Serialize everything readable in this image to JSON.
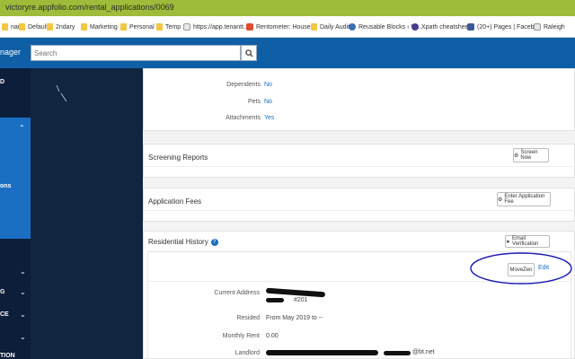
{
  "browser": {
    "url": "victoryre.appfolio.com/rental_applications/0069",
    "bookmarks": [
      {
        "label": "nary",
        "icon": "folder-icon"
      },
      {
        "label": "Default",
        "icon": "folder-icon"
      },
      {
        "label": "2ndary",
        "icon": "folder-icon"
      },
      {
        "label": "Marketing",
        "icon": "folder-icon"
      },
      {
        "label": "Personal",
        "icon": "folder-icon"
      },
      {
        "label": "Temp",
        "icon": "folder-icon"
      },
      {
        "label": "https://app.tenantt...",
        "icon": "page-icon"
      },
      {
        "label": "Rentometer: House...",
        "icon": "rentometer-icon"
      },
      {
        "label": "Daily Audit",
        "icon": "folder-icon"
      },
      {
        "label": "Reusable Blocks ‹ Vi...",
        "icon": "wordpress-icon"
      },
      {
        "label": "Xpath cheatsheet",
        "icon": "xpath-icon"
      },
      {
        "label": "(20+) Pages | Faceb...",
        "icon": "facebook-icon"
      },
      {
        "label": "Raleigh",
        "icon": "page-icon"
      }
    ]
  },
  "topnav": {
    "brand_fragment": "nager",
    "search_placeholder": "Search"
  },
  "sidebar": {
    "items": [
      {
        "label": "D"
      },
      {
        "label": "ons"
      },
      {
        "label": "G"
      },
      {
        "label": "CE"
      },
      {
        "label": "TION"
      }
    ]
  },
  "details": {
    "rows": [
      {
        "label": "Dependents",
        "value": "No"
      },
      {
        "label": "Pets",
        "value": "No"
      },
      {
        "label": "Attachments",
        "value": "Yes"
      }
    ]
  },
  "screening": {
    "title": "Screening Reports",
    "button": "Screen Now"
  },
  "fees": {
    "title": "Application Fees",
    "button": "Enter Application Fee"
  },
  "residential": {
    "title": "Residential History",
    "email_button": "Email Verification",
    "movein_button": "MoveZen",
    "edit_link": "Edit",
    "current_address_label": "Current Address",
    "address_fragment": "#201",
    "resided_label": "Resided",
    "resided_value": "From May 2019 to --",
    "rent_label": "Monthly Rent",
    "rent_value": "0.00",
    "landlord_label": "Landlord",
    "landlord_fragment": "@bt.net"
  },
  "colors": {
    "urlbar": "#9fbb3a",
    "topnav": "#0f5fa6",
    "sidebar": "#0d1e3a",
    "accent": "#1a6fc3",
    "annotation": "#1b1bb0"
  }
}
